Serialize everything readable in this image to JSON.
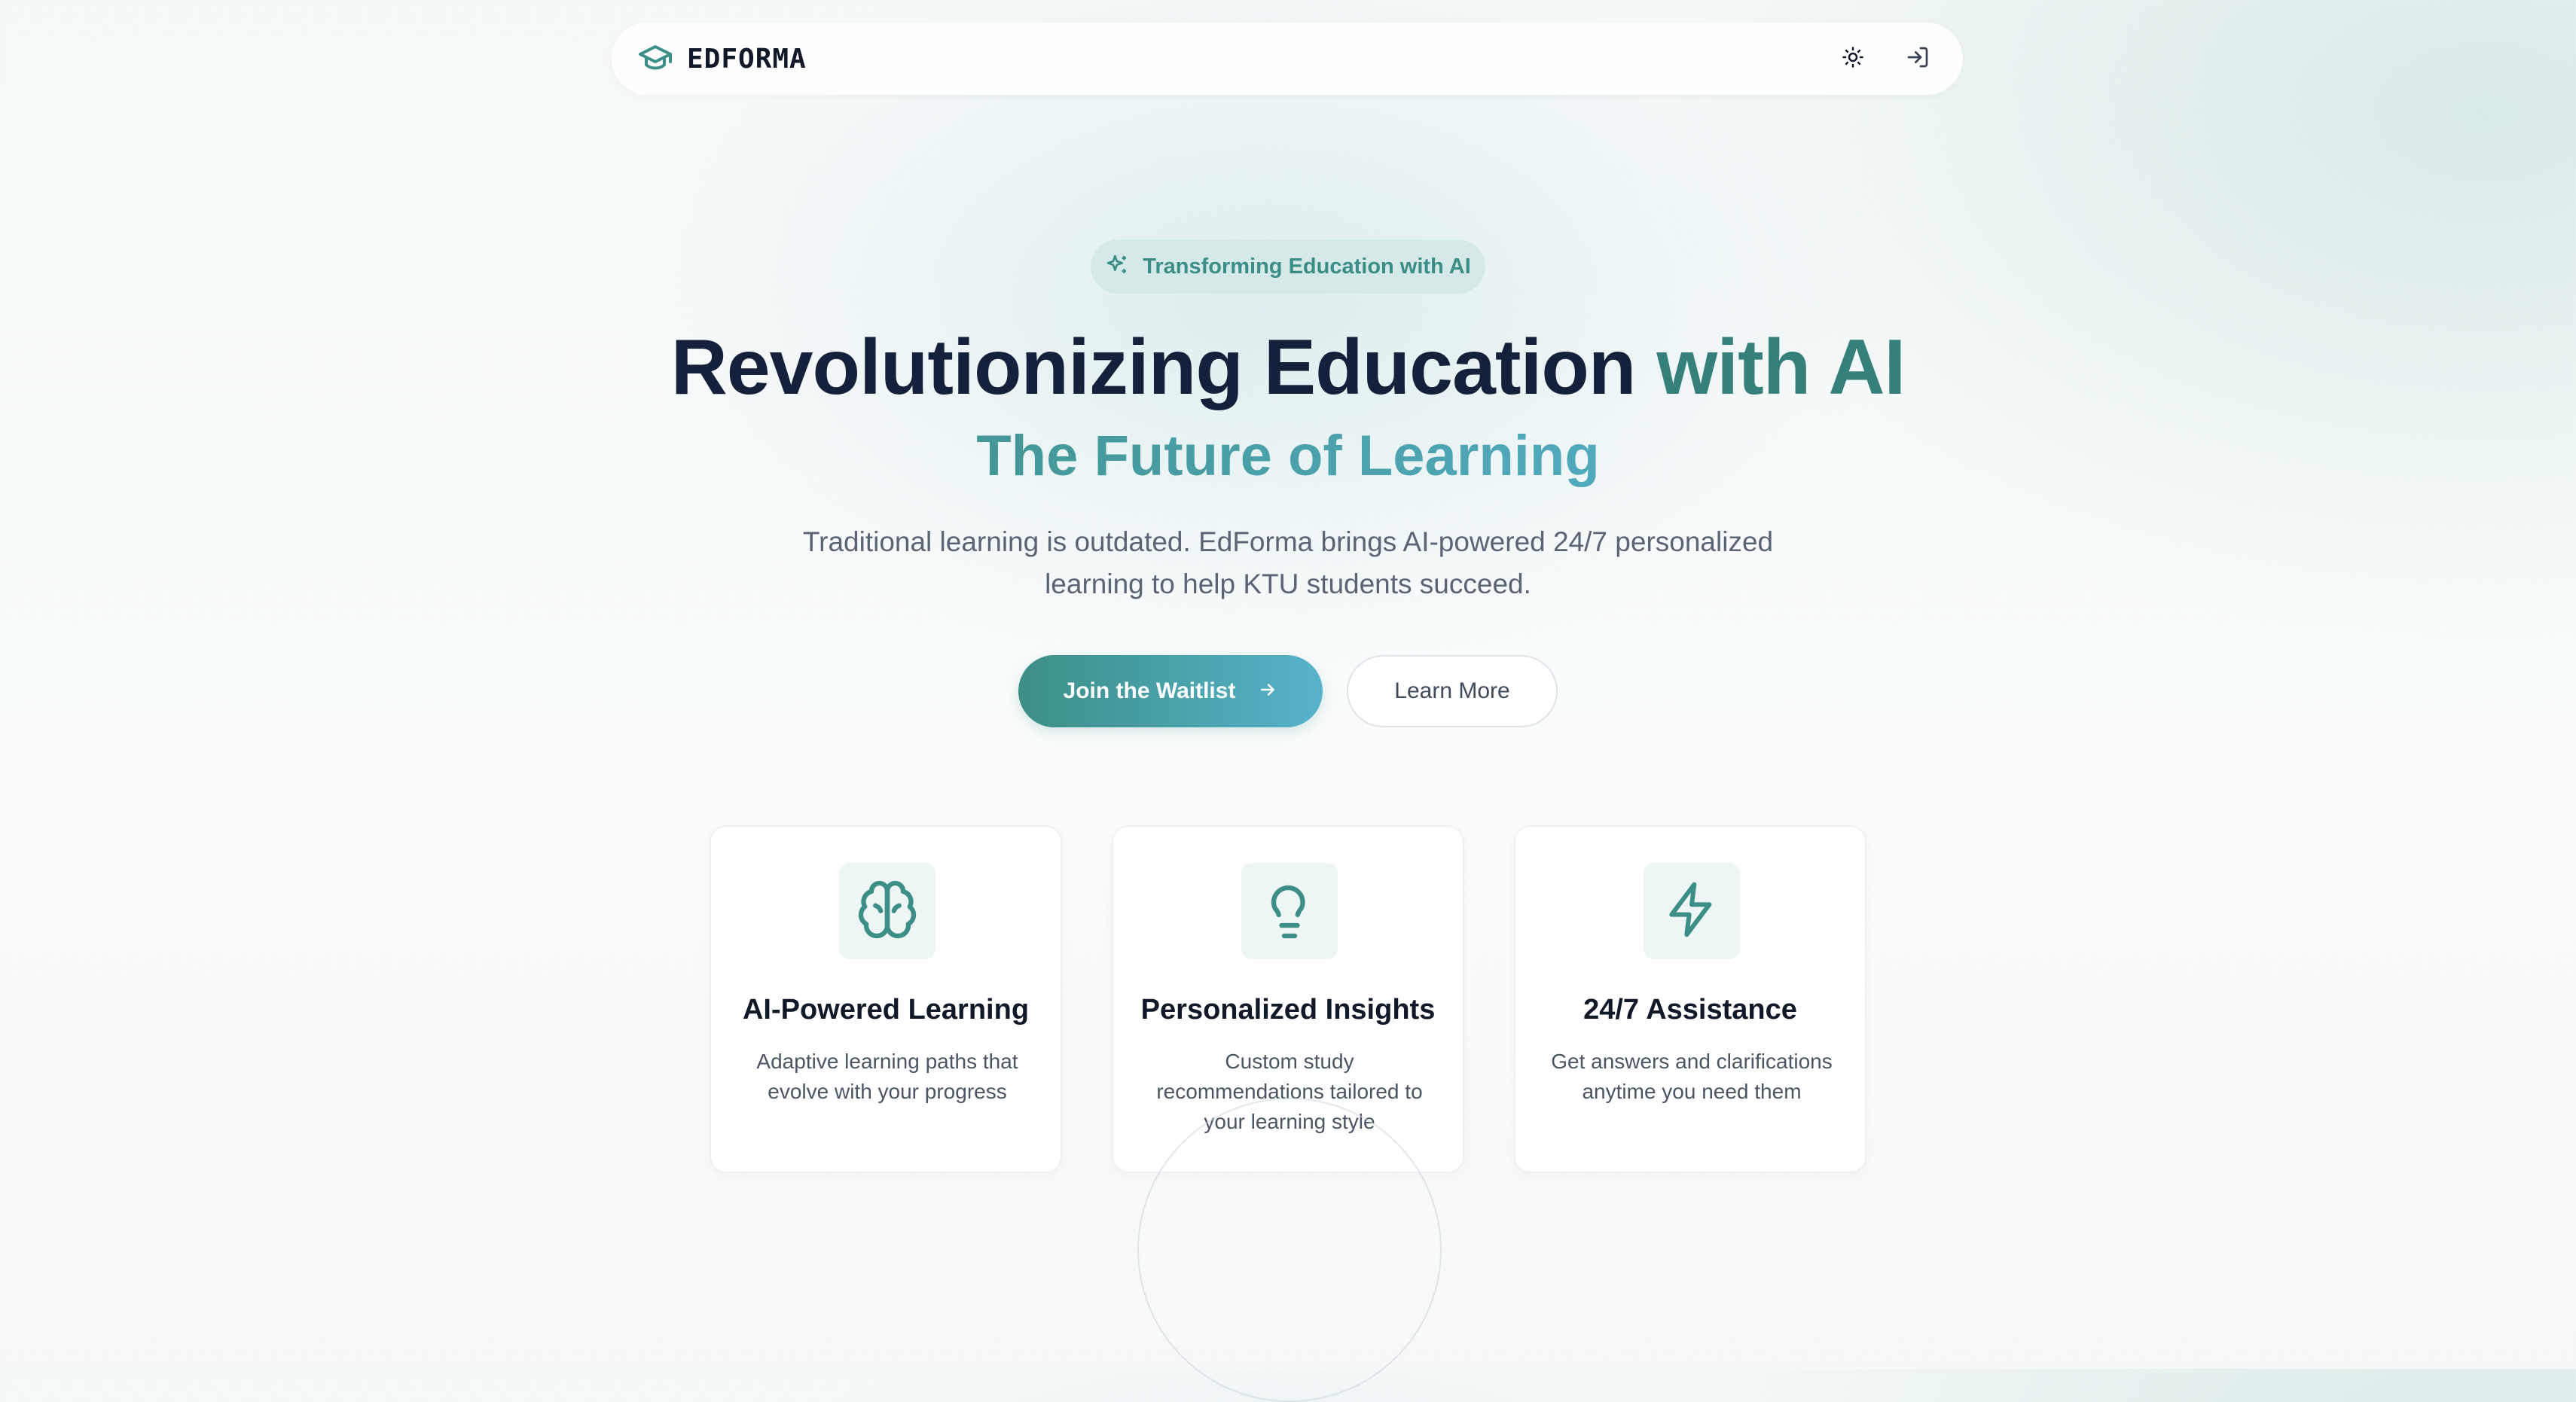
{
  "nav": {
    "brand": "EDFORMA",
    "logo_icon": "graduation-cap-icon",
    "theme_icon": "sun-icon",
    "login_icon": "log-in-icon"
  },
  "hero": {
    "badge_icon": "sparkles-icon",
    "badge": "Transforming Education with AI",
    "headline_part1": "Revolutionizing Education ",
    "headline_part2": "with AI",
    "subheadline": "The Future of Learning",
    "description": "Traditional learning is outdated. EdForma brings AI-powered 24/7 personalized learning to help KTU students succeed.",
    "primary_button": "Join the Waitlist",
    "primary_button_icon": "arrow-right-icon",
    "secondary_button": "Learn More"
  },
  "features": [
    {
      "icon": "brain-icon",
      "title": "AI-Powered Learning",
      "description": "Adaptive learning paths that evolve with your progress"
    },
    {
      "icon": "lightbulb-icon",
      "title": "Personalized Insights",
      "description": "Custom study recommendations tailored to your learning style"
    },
    {
      "icon": "zap-icon",
      "title": "24/7 Assistance",
      "description": "Get answers and clarifications anytime you need them"
    }
  ],
  "colors": {
    "accent": "#3c8f86",
    "accent_light": "#56b3cb",
    "heading": "#15203a",
    "body_text": "#5b6474"
  }
}
